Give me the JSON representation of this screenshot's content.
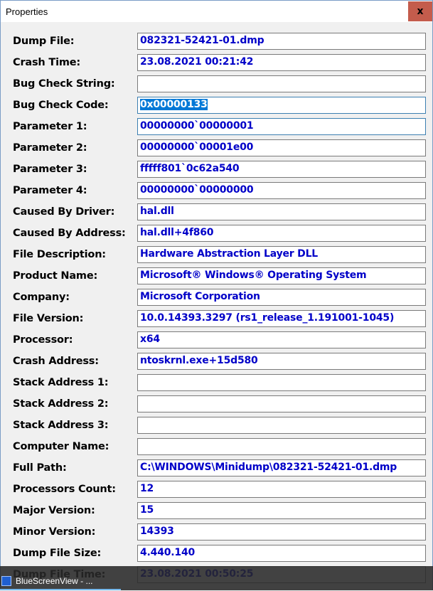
{
  "window": {
    "title": "Properties",
    "close_label": "x"
  },
  "rows": [
    {
      "label": "Dump File:",
      "value": "082321-52421-01.dmp"
    },
    {
      "label": "Crash Time:",
      "value": "23.08.2021 00:21:42"
    },
    {
      "label": "Bug Check String:",
      "value": ""
    },
    {
      "label": "Bug Check Code:",
      "value": "0x00000133"
    },
    {
      "label": "Parameter 1:",
      "value": "00000000`00000001"
    },
    {
      "label": "Parameter 2:",
      "value": "00000000`00001e00"
    },
    {
      "label": "Parameter 3:",
      "value": "fffff801`0c62a540"
    },
    {
      "label": "Parameter 4:",
      "value": "00000000`00000000"
    },
    {
      "label": "Caused By Driver:",
      "value": "hal.dll"
    },
    {
      "label": "Caused By Address:",
      "value": "hal.dll+4f860"
    },
    {
      "label": "File Description:",
      "value": "Hardware Abstraction Layer DLL"
    },
    {
      "label": "Product Name:",
      "value": "Microsoft® Windows® Operating System"
    },
    {
      "label": "Company:",
      "value": "Microsoft Corporation"
    },
    {
      "label": "File Version:",
      "value": "10.0.14393.3297 (rs1_release_1.191001-1045)"
    },
    {
      "label": "Processor:",
      "value": "x64"
    },
    {
      "label": "Crash Address:",
      "value": "ntoskrnl.exe+15d580"
    },
    {
      "label": "Stack Address 1:",
      "value": ""
    },
    {
      "label": "Stack Address 2:",
      "value": ""
    },
    {
      "label": "Stack Address 3:",
      "value": ""
    },
    {
      "label": "Computer Name:",
      "value": ""
    },
    {
      "label": "Full Path:",
      "value": "C:\\WINDOWS\\Minidump\\082321-52421-01.dmp"
    },
    {
      "label": "Processors Count:",
      "value": "12"
    },
    {
      "label": "Major Version:",
      "value": "15"
    },
    {
      "label": "Minor Version:",
      "value": "14393"
    },
    {
      "label": "Dump File Size:",
      "value": "4.440.140"
    },
    {
      "label": "Dump File Time:",
      "value": "23.08.2021 00:50:25"
    }
  ],
  "taskbar": {
    "item_label": "BlueScreenView - ..."
  }
}
